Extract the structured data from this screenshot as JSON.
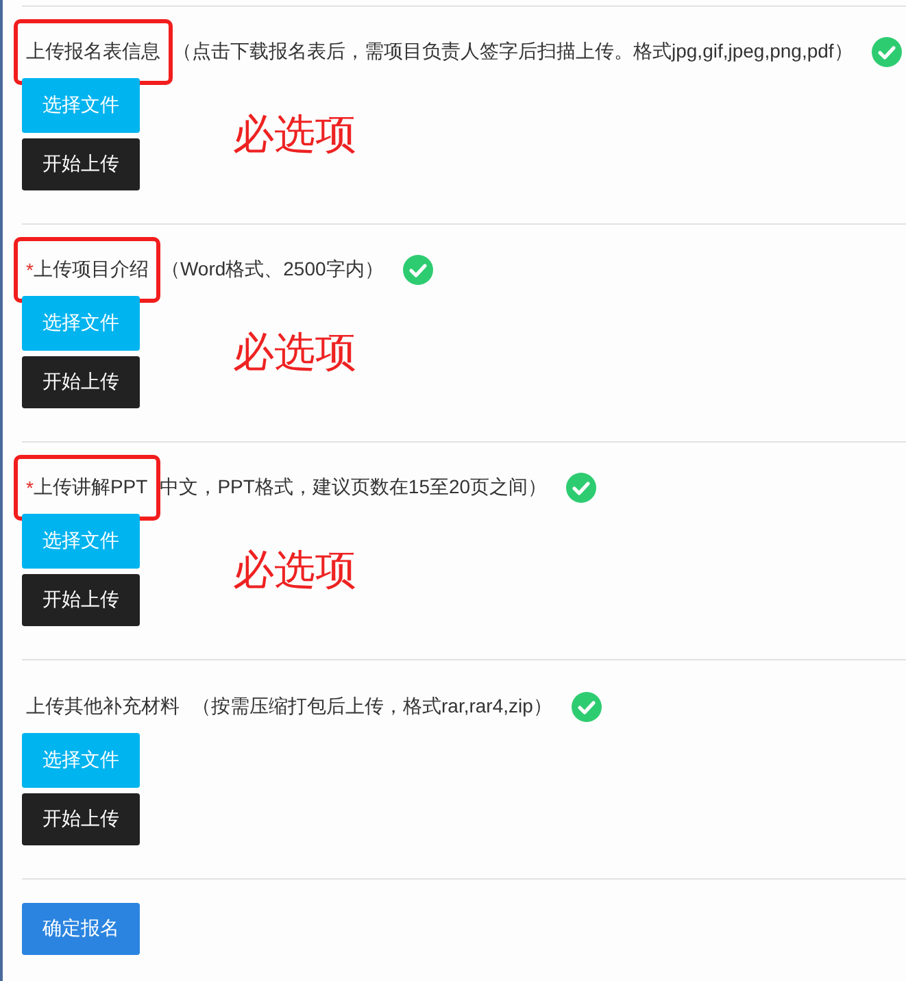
{
  "sections": [
    {
      "label": "上传报名表信息",
      "description": "（点击下载报名表后，需项目负责人签字后扫描上传。格式jpg,gif,jpeg,png,pdf）",
      "annotated": true,
      "uploaded": true,
      "buttons": [
        "选择文件",
        "开始上传"
      ],
      "note": "必选项"
    },
    {
      "required_mark": "*",
      "label": "上传项目介绍",
      "description": "（Word格式、2500字内）",
      "annotated": true,
      "uploaded": true,
      "buttons": [
        "选择文件",
        "开始上传"
      ],
      "note": "必选项"
    },
    {
      "required_mark": "*",
      "label": "上传讲解PPT",
      "description": "中文，PPT格式，建议页数在15至20页之间）",
      "annotated": true,
      "uploaded": true,
      "buttons": [
        "选择文件",
        "开始上传"
      ],
      "note": "必选项"
    },
    {
      "label": "上传其他补充材料",
      "description": "（按需压缩打包后上传，格式rar,rar4,zip）",
      "annotated": false,
      "uploaded": true,
      "buttons": [
        "选择文件",
        "开始上传"
      ]
    }
  ],
  "submit_button": "确定报名"
}
